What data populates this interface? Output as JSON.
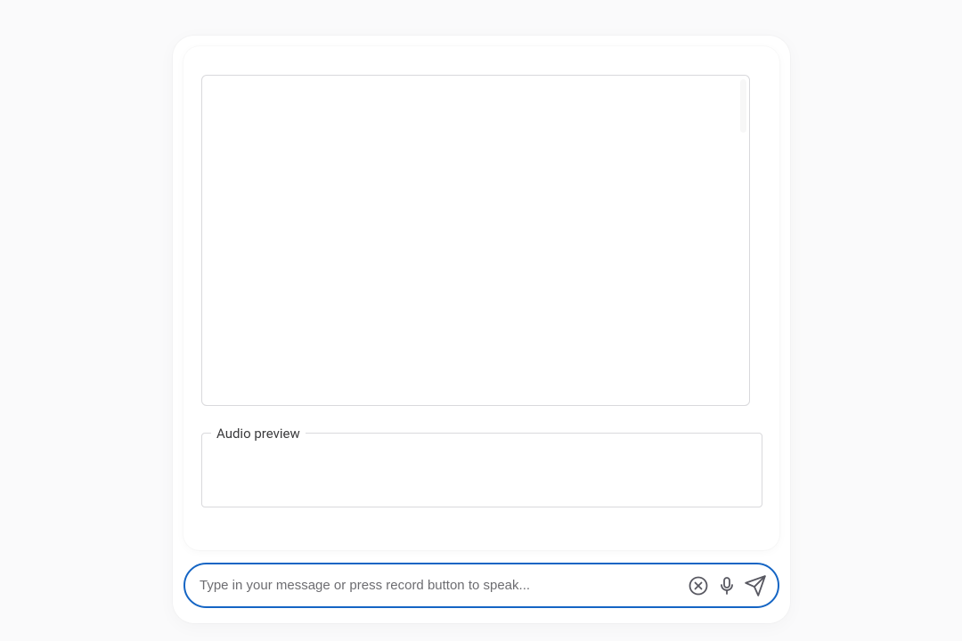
{
  "audio_preview": {
    "label": "Audio preview"
  },
  "composer": {
    "placeholder": "Type in your message or press record button to speak...",
    "value": ""
  },
  "icons": {
    "close": "close-icon",
    "microphone": "microphone-icon",
    "send": "send-icon"
  },
  "colors": {
    "input_border": "#1565c4",
    "panel_border": "#d9d9dc",
    "placeholder": "#6d6d71"
  }
}
